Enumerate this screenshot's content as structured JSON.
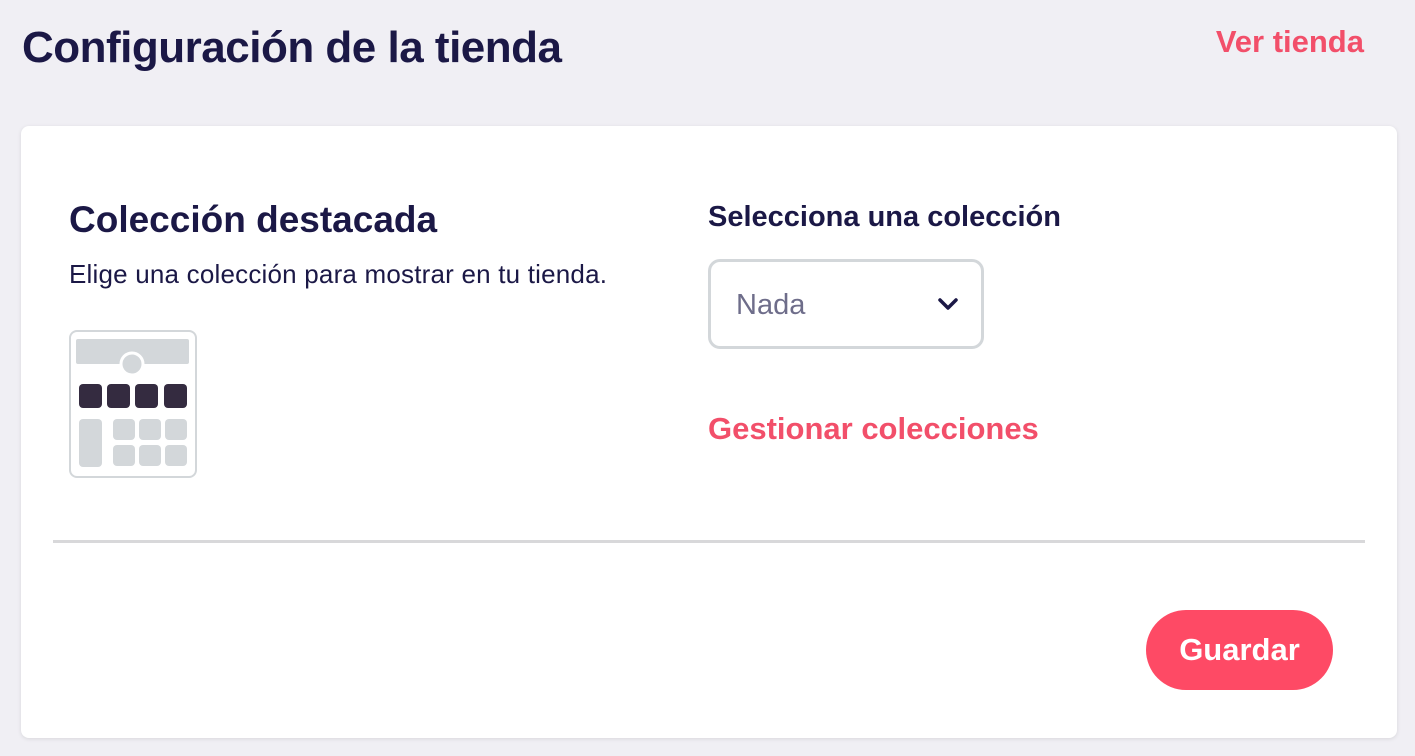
{
  "header": {
    "title": "Configuración de la tienda",
    "view_store_label": "Ver tienda"
  },
  "featured_collection": {
    "title": "Colección destacada",
    "description": "Elige una colección para mostrar en tu tienda.",
    "icon": "collection-layout-icon",
    "select_label": "Selecciona una colección",
    "selected_value": "Nada",
    "manage_link_label": "Gestionar colecciones"
  },
  "footer": {
    "save_label": "Guardar"
  },
  "colors": {
    "accent": "#f24f6a",
    "button": "#fe4a65",
    "text": "#1b1846",
    "background": "#f0eff4"
  }
}
